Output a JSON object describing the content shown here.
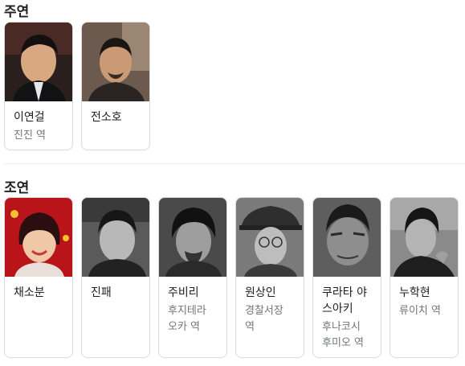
{
  "main_cast": {
    "title": "주연",
    "people": [
      {
        "name": "이연걸",
        "role": "진진 역"
      },
      {
        "name": "전소호",
        "role": ""
      }
    ]
  },
  "supporting_cast": {
    "title": "조연",
    "people": [
      {
        "name": "채소분",
        "role": ""
      },
      {
        "name": "진패",
        "role": ""
      },
      {
        "name": "주비리",
        "role": "후지테라\n오카 역"
      },
      {
        "name": "원상인",
        "role": "경찰서장\n역"
      },
      {
        "name": "쿠라타 야\n스아키",
        "role": "후나코시\n후미오 역"
      },
      {
        "name": "누학현",
        "role": "류이치 역"
      }
    ]
  }
}
